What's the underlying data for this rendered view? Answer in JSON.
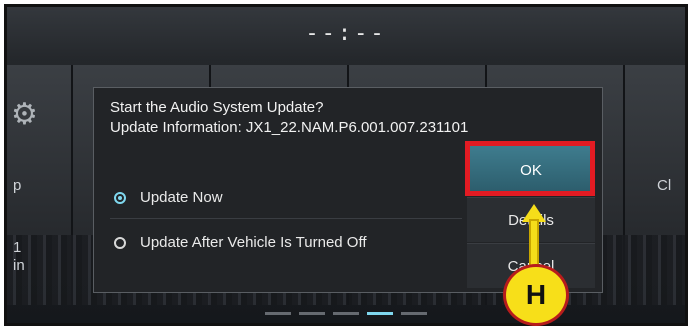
{
  "status_bar": {
    "clock": "--:--"
  },
  "background": {
    "left_label_1": "p",
    "left_label_2": "1",
    "left_label_3": "in",
    "right_label": "Cl"
  },
  "dialog": {
    "title": "Start the Audio System Update?",
    "info": "Update Information: JX1_22.NAM.P6.001.007.231101",
    "options": [
      {
        "label": "Update Now",
        "selected": true
      },
      {
        "label": "Update After Vehicle Is Turned Off",
        "selected": false
      }
    ],
    "buttons": {
      "ok": "OK",
      "details": "Details",
      "cancel": "Cancel"
    }
  },
  "annotation": {
    "badge": "H",
    "highlight_color": "#e31b23",
    "arrow_color": "#f5dd1a"
  },
  "colors": {
    "accent": "#7fd7ee",
    "ok_button": "#3f7d8f"
  }
}
